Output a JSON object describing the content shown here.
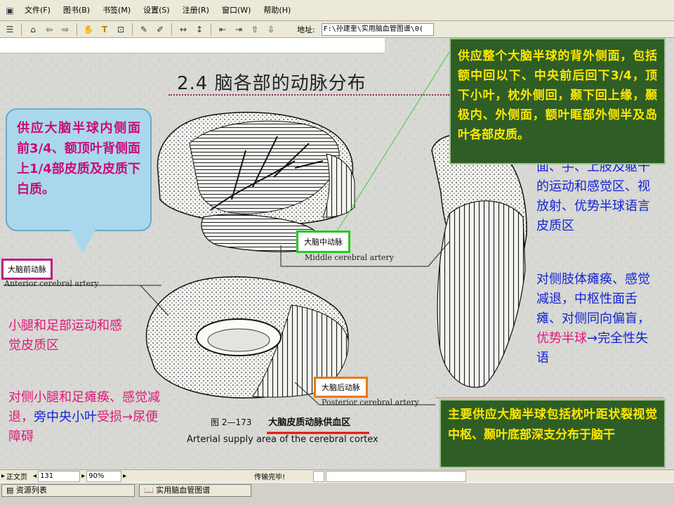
{
  "menu": [
    "文件(F)",
    "图书(B)",
    "书签(M)",
    "设置(S)",
    "注册(R)",
    "窗口(W)",
    "帮助(H)"
  ],
  "toolbar": {
    "address_label": "地址:",
    "address_value": "F:\\孙建奎\\实用脑血管图谱\\0("
  },
  "slide": {
    "title": "2.4  脑各部的动脉分布",
    "bubble_text": "供应大脑半球内侧面前3/4、额顶叶背侧面上1/4部皮质及皮质下白质。",
    "label_aca_cn": "大脑前动脉",
    "label_aca_en": "Anterior cerebral artery",
    "label_mca_cn": "大脑中动脉",
    "label_mca_en": "Middle cerebral artery",
    "label_pca_cn": "大脑后动脉",
    "label_pca_en": "Posterior cerebral artery",
    "pink_text_1": "小腿和足部运动和感觉皮质区",
    "pink_text_2a": "对侧小腿和足瘫痪、感觉减退，",
    "pink_text_2b": "旁中央小叶",
    "pink_text_2c": "受损→尿便障碍",
    "blue_text_1": "面、手、上肢及躯干的运动和感觉区、视放射、优势半球语言皮质区",
    "blue_text_2a": "对侧肢体瘫痪、感觉减退，中枢性面舌瘫、对侧同向偏盲，",
    "blue_text_2b": "优势半球",
    "blue_text_2c": "→完全性失语",
    "green_top": "供应整个大脑半球的背外侧面，包括额中回以下、中央前后回下3/4，顶下小叶，枕外侧回，颞下回上缘，颞极内、外侧面，额叶眶部外侧半及岛叶各部皮质。",
    "green_bottom": "主要供应大脑半球包括枕叶距状裂视觉中枢、颞叶底部深支分布于脑干",
    "fig_number": "图 2—173",
    "fig_title": "大脑皮质动脉供血区",
    "fig_title_en": "Arterial supply area of the cerebral cortex"
  },
  "statusbar": {
    "page_label": "正文页",
    "page_number": "131",
    "zoom": "90%",
    "status": "传输完毕!"
  },
  "taskbar": {
    "left_panel": "资源列表",
    "doc_button": "实用脑血管图谱"
  },
  "colors": {
    "bubble_bg": "#a9d8ec",
    "pink": "#e0197a",
    "blue": "#1424d4",
    "green_box": "#2e5e26",
    "green_text": "#ffe600",
    "aca_border": "#c0188a",
    "mca_border": "#22cc22",
    "pca_border": "#e87a10",
    "underline": "#e01010"
  }
}
